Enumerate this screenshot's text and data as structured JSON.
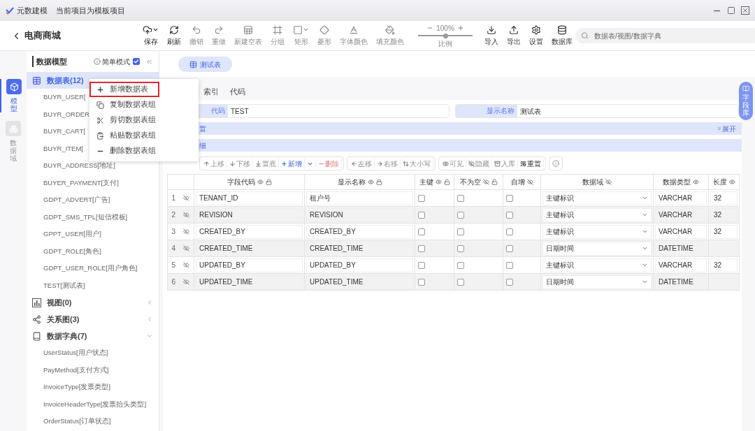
{
  "window": {
    "app_name": "元数建模",
    "subtitle": "当前项目为模板项目"
  },
  "toolbar": {
    "project": "电商商城",
    "tools": [
      {
        "kind": "save",
        "label": "保存",
        "disabled": false
      },
      {
        "kind": "refresh",
        "label": "刷新",
        "disabled": false
      },
      {
        "kind": "undo",
        "label": "撤销",
        "disabled": true
      },
      {
        "kind": "redo",
        "label": "重做",
        "disabled": true
      },
      {
        "kind": "new-table",
        "label": "新建空表",
        "disabled": true
      },
      {
        "kind": "group",
        "label": "分组",
        "disabled": true
      },
      {
        "kind": "rect",
        "label": "矩形",
        "disabled": true
      },
      {
        "kind": "diamond",
        "label": "菱形",
        "disabled": true
      },
      {
        "kind": "font-color",
        "label": "字体颜色",
        "disabled": true
      },
      {
        "kind": "fill-color",
        "label": "填充颜色",
        "disabled": true
      }
    ],
    "zoom": {
      "value": "100%",
      "label": "比例",
      "level": 0.5
    },
    "tools_right": [
      {
        "kind": "import",
        "label": "导入"
      },
      {
        "kind": "export",
        "label": "导出"
      },
      {
        "kind": "settings",
        "label": "设置"
      },
      {
        "kind": "database",
        "label": "数据库"
      }
    ],
    "search": {
      "placeholder": "数据表/视图/数据字典"
    }
  },
  "rail": [
    {
      "kind": "model",
      "label": "模型",
      "selected": true
    },
    {
      "kind": "domain",
      "label": "数据域",
      "selected": false
    }
  ],
  "sidebar": {
    "title": "数据模型",
    "simple_mode": {
      "label": "简单模式",
      "checked": true
    },
    "groups": [
      {
        "kind": "table",
        "label": "数据表(12)",
        "expanded": true,
        "selected": true,
        "children": [
          "BUYR_USER[",
          "BUYR_ORDER",
          "BUYR_CART[",
          "BUYR_ITEM[",
          "BUYR_ADDRESS[地址]",
          "BUYER_PAYMENT[支付]",
          "GDPT_ADVERT[广告]",
          "GDPT_SMS_TPL[短信模板]",
          "GPPT_USER[用户]",
          "GDPT_ROLE[角色]",
          "GDPT_USER_ROLE[用户角色]",
          "TEST[测试表]"
        ]
      },
      {
        "kind": "view",
        "label": "视图(0)",
        "expanded": false,
        "selected": false
      },
      {
        "kind": "relation",
        "label": "关系图(3)",
        "expanded": false,
        "selected": false
      },
      {
        "kind": "dict",
        "label": "数据字典(7)",
        "expanded": true,
        "selected": false,
        "children": [
          "UserStatus[用户状态]",
          "PayMethod[支付方式]",
          "InvoiceType[发票类型]",
          "InvoiceHeaderType[发票抬头类型]",
          "OrderStatus[订单状态]"
        ]
      }
    ]
  },
  "context_menu": [
    {
      "kind": "add",
      "label": "新增数据表",
      "selected": true
    },
    {
      "kind": "copy",
      "label": "复制数据表组",
      "selected": false
    },
    {
      "kind": "cut",
      "label": "剪切数据表组",
      "selected": false
    },
    {
      "kind": "paste",
      "label": "粘贴数据表组",
      "selected": false
    },
    {
      "kind": "delete",
      "label": "删除数据表组",
      "selected": false
    }
  ],
  "open_tab": {
    "label": "测试表"
  },
  "inner_tabs": [
    {
      "label": "索引",
      "selected": false
    },
    {
      "label": "代码",
      "selected": false
    }
  ],
  "form": {
    "code": {
      "label": "代码",
      "value": "TEST"
    },
    "display_name": {
      "label": "显示名称",
      "value": "测试表"
    }
  },
  "sections": [
    {
      "label": "置",
      "expand": "展开"
    },
    {
      "label": "细"
    }
  ],
  "field_library": {
    "label": "字段库"
  },
  "table_toolbar": [
    [
      {
        "kind": "up",
        "label": "上移",
        "disabled": true
      },
      {
        "kind": "down",
        "label": "下移",
        "disabled": true
      },
      {
        "kind": "bottom",
        "label": "置底",
        "disabled": true
      },
      {
        "kind": "add",
        "label": "新增",
        "disabled": false
      },
      {
        "kind": "caret",
        "disabled": false
      },
      {
        "kind": "delete",
        "label": "删除",
        "disabled": true
      }
    ],
    [
      {
        "kind": "left",
        "label": "左移",
        "disabled": true
      },
      {
        "kind": "right",
        "label": "右移",
        "disabled": true
      },
      {
        "kind": "case",
        "label": "大小写",
        "disabled": true
      }
    ],
    [
      {
        "kind": "show",
        "label": "可见",
        "disabled": true
      },
      {
        "kind": "hide",
        "label": "隐藏",
        "disabled": true
      },
      {
        "kind": "store",
        "label": "入库",
        "disabled": true
      },
      {
        "kind": "reset",
        "label": "重置",
        "disabled": false
      }
    ]
  ],
  "columns": [
    {
      "label": "字段代码",
      "visible": true,
      "locked": true
    },
    {
      "label": "显示名称",
      "visible": true,
      "locked": true
    },
    {
      "label": "主键",
      "visible": true,
      "locked": false
    },
    {
      "label": "不为空",
      "visible": false,
      "locked": false
    },
    {
      "label": "自增",
      "visible": false
    },
    {
      "label": "数据域",
      "visible": false
    },
    {
      "label": "数据类型",
      "visible": true
    },
    {
      "label": "长度",
      "visible": true
    }
  ],
  "rows": [
    {
      "index": "1",
      "code": "TENANT_ID",
      "name": "租户号",
      "primary_key": false,
      "not_null": false,
      "auto_increment": false,
      "domain": "主键标识",
      "type": "VARCHAR",
      "length": "32"
    },
    {
      "index": "2",
      "code": "REVISION",
      "name": "REVISION",
      "primary_key": false,
      "not_null": false,
      "auto_increment": false,
      "domain": "主键标识",
      "type": "VARCHAR",
      "length": "32"
    },
    {
      "index": "3",
      "code": "CREATED_BY",
      "name": "CREATED_BY",
      "primary_key": false,
      "not_null": false,
      "auto_increment": false,
      "domain": "主键标识",
      "type": "VARCHAR",
      "length": "32"
    },
    {
      "index": "4",
      "code": "CREATED_TIME",
      "name": "CREATED_TIME",
      "primary_key": false,
      "not_null": false,
      "auto_increment": false,
      "domain": "日期时间",
      "type": "DATETIME"
    },
    {
      "index": "5",
      "code": "UPDATED_BY",
      "name": "UPDATED_BY",
      "primary_key": false,
      "not_null": false,
      "auto_increment": false,
      "domain": "主键标识",
      "type": "VARCHAR",
      "length": "32"
    },
    {
      "index": "6",
      "code": "UPDATED_TIME",
      "name": "UPDATED_TIME",
      "primary_key": false,
      "not_null": false,
      "auto_increment": false,
      "domain": "日期时间",
      "type": "DATETIME"
    }
  ]
}
